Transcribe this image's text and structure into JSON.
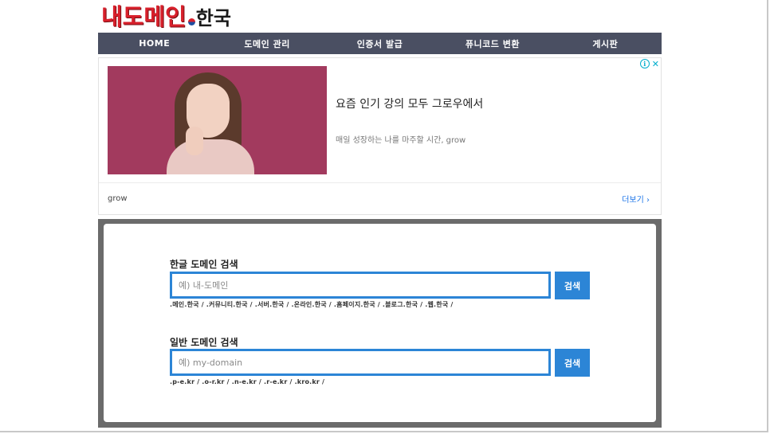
{
  "logo": {
    "main": "내도메인",
    "kr": "한국"
  },
  "nav": [
    "HOME",
    "도메인 관리",
    "인증서 발급",
    "퓨니코드 변환",
    "게시판"
  ],
  "ad": {
    "title": "요즘 인기 강의 모두 그로우에서",
    "subtitle": "매일 성장하는 나를 마주할 시간, grow",
    "brand": "grow",
    "more": "더보기 ›",
    "info_icon": "i",
    "close_icon": "✕"
  },
  "search": {
    "korean": {
      "label": "한글 도메인 검색",
      "placeholder": "예) 내-도메인",
      "button": "검색",
      "tlds": ".메인.한국 / .커뮤니티.한국 / .서버.한국 / .온라인.한국 / .홈페이지.한국 / .블로그.한국 / .웹.한국 /"
    },
    "general": {
      "label": "일반 도메인 검색",
      "placeholder": "예) my-domain",
      "button": "검색",
      "tlds": ".p-e.kr / .o-r.kr / .n-e.kr / .r-e.kr / .kro.kr /"
    }
  }
}
